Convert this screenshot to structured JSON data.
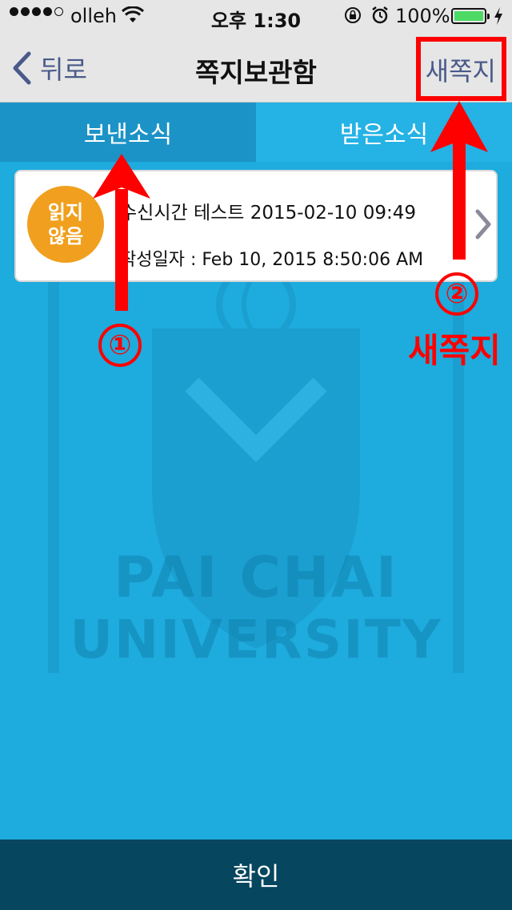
{
  "status_bar": {
    "carrier": "olleh",
    "time": "오후 1:30",
    "battery_pct": "100%",
    "battery_color": "#4cd964"
  },
  "nav": {
    "back_label": "뒤로",
    "title": "쪽지보관함",
    "new_message": "새쪽지"
  },
  "tabs": [
    {
      "label": "보낸소식",
      "active": true
    },
    {
      "label": "받은소식",
      "active": false
    }
  ],
  "messages": [
    {
      "badge_line1": "읽지",
      "badge_line2": "않음",
      "title": "수신시간 테스트 2015-02-10 09:49",
      "date": "작성일자 : Feb 10, 2015 8:50:06 AM",
      "badge_color": "#f0a01e"
    }
  ],
  "watermark": {
    "line1": "PAI CHAI",
    "line2": "UNIVERSITY"
  },
  "annotations": {
    "num1": "①",
    "num2": "②",
    "label2": "새쪽지",
    "color": "#ff0000"
  },
  "footer": {
    "confirm_label": "확인",
    "color": "#06465e"
  }
}
